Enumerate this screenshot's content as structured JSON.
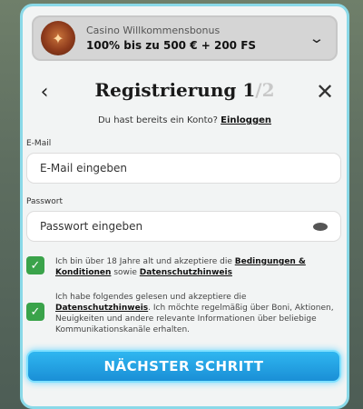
{
  "bonus": {
    "title": "Casino Willkommensbonus",
    "value": "100% bis zu 500 € + 200 FS",
    "icon": "casino-chip-icon"
  },
  "header": {
    "title": "Registrierung",
    "page_current": "1",
    "page_total": "/2"
  },
  "login_prompt": {
    "text": "Du hast bereits ein Konto?",
    "link": "Einloggen"
  },
  "email": {
    "label": "E-Mail",
    "placeholder": "E-Mail eingeben"
  },
  "password": {
    "label": "Passwort",
    "placeholder": "Passwort eingeben"
  },
  "consent_age": {
    "text_before": "Ich bin über 18 Jahre alt und akzeptiere die",
    "link_terms": "Bedingungen & Konditionen",
    "text_mid": "sowie",
    "link_privacy": "Datenschutzhinweis"
  },
  "consent_marketing": {
    "text_before": "Ich habe folgendes gelesen und akzeptiere die",
    "link_privacy": "Datenschutzhinweis",
    "text_after": ". Ich möchte regelmäßig über Boni, Aktionen, Neuigkeiten und andere relevante Informationen über beliebige Kommunikationskanäle erhalten."
  },
  "next_button": "NÄCHSTER SCHRITT",
  "colors": {
    "accent_button": "#1fa0e0",
    "checkbox": "#3aa34a",
    "modal_border": "#8ad9e8"
  }
}
